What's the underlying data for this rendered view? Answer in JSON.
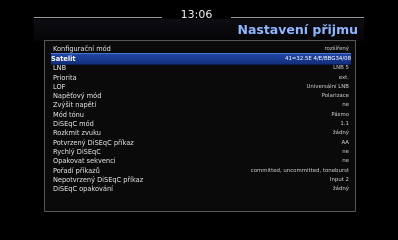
{
  "header": {
    "clock": "13:06",
    "title": "Nastavení přijmu"
  },
  "settings": [
    {
      "label": "Konfigurační mód",
      "value": "rozšířený"
    },
    {
      "label": "Satelit",
      "value": "41=32.5E 4/E/BBG34/08",
      "selected": true
    },
    {
      "label": "LNB",
      "value": "LNB 5"
    },
    {
      "label": "Priorita",
      "value": "ext."
    },
    {
      "label": "LOF",
      "value": "Universální LNB"
    },
    {
      "label": "Napěťový mód",
      "value": "Polarizace"
    },
    {
      "label": "Zvýšit napětí",
      "value": "ne"
    },
    {
      "label": "Mód tónu",
      "value": "Pásmo"
    },
    {
      "label": "DiSEqC mód",
      "value": "1.1"
    },
    {
      "label": "Rozkmit zvuku",
      "value": "žádný"
    },
    {
      "label": "Potvrzený DiSEqC příkaz",
      "value": "AA"
    },
    {
      "label": "Rychlý DiSEqC",
      "value": "ne"
    },
    {
      "label": "Opakovat sekvenci",
      "value": "ne"
    },
    {
      "label": "Pořadí příkazů",
      "value": "committed, uncommitted, toneburst"
    },
    {
      "label": "Nepotvrzený DiSEqC příkaz",
      "value": "Input 2"
    },
    {
      "label": "DiSEqC opakování",
      "value": "žádný"
    }
  ]
}
